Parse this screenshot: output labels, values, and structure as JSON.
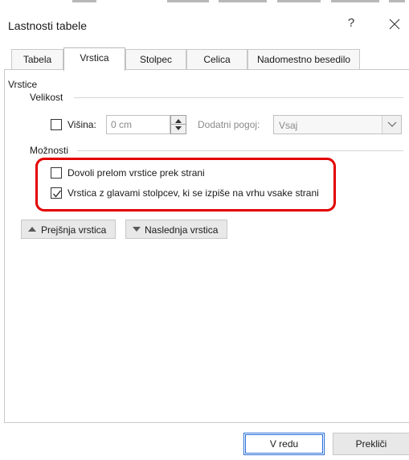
{
  "dialog": {
    "title": "Lastnosti tabele",
    "help": "?"
  },
  "tabs": [
    {
      "label": "Tabela",
      "active": false
    },
    {
      "label": "Vrstica",
      "active": true
    },
    {
      "label": "Stolpec",
      "active": false
    },
    {
      "label": "Celica",
      "active": false
    },
    {
      "label": "Nadomestno besedilo",
      "active": false
    }
  ],
  "rows_section": {
    "title": "Vrstice",
    "size_group": "Velikost",
    "height_label": "Višina:",
    "height_value": "0 cm",
    "extra_condition_label": "Dodatni pogoj:",
    "extra_condition_value": "Vsaj",
    "options_group": "Možnosti",
    "option_break": {
      "label": "Dovoli prelom vrstice prek strani",
      "checked": false
    },
    "option_header": {
      "label": "Vrstica z glavami stolpcev, ki se izpiše na vrhu vsake strani",
      "checked": true
    }
  },
  "nav": {
    "prev_label": "Prejšnja vrstica",
    "next_label": "Naslednja vrstica"
  },
  "footer": {
    "ok_label": "V redu",
    "cancel_label": "Prekliči"
  },
  "colors": {
    "highlight": "#e30000",
    "default_button_border": "#2a6fd8"
  }
}
